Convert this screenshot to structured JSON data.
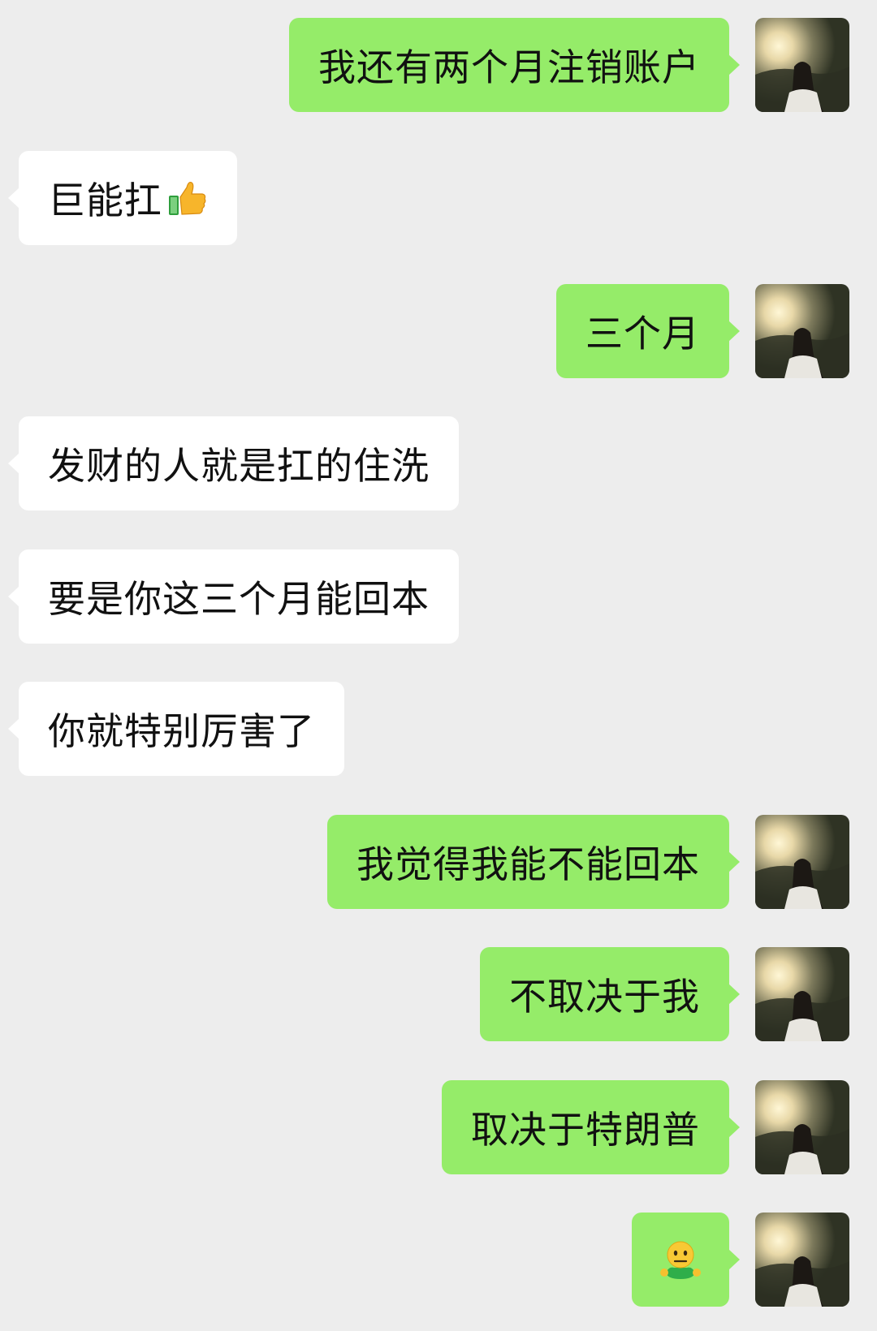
{
  "colors": {
    "background": "#ededed",
    "outgoing_bubble": "#95ec69",
    "incoming_bubble": "#ffffff",
    "text": "#111111"
  },
  "messages": [
    {
      "direction": "outgoing",
      "text": "我还有两个月注销账户"
    },
    {
      "direction": "incoming",
      "text": "巨能扛",
      "trailing_icon": "thumbs-up-icon"
    },
    {
      "direction": "outgoing",
      "text": "三个月"
    },
    {
      "direction": "incoming",
      "text": "发财的人就是扛的住洗"
    },
    {
      "direction": "incoming",
      "text": "要是你这三个月能回本"
    },
    {
      "direction": "incoming",
      "text": "你就特别厉害了"
    },
    {
      "direction": "outgoing",
      "text": "我觉得我能不能回本"
    },
    {
      "direction": "outgoing",
      "text": "不取决于我"
    },
    {
      "direction": "outgoing",
      "text": "取决于特朗普"
    },
    {
      "direction": "outgoing",
      "text": "",
      "sticker_icon": "shrugging-face-icon"
    }
  ],
  "avatar_icon": "user-avatar-photo"
}
